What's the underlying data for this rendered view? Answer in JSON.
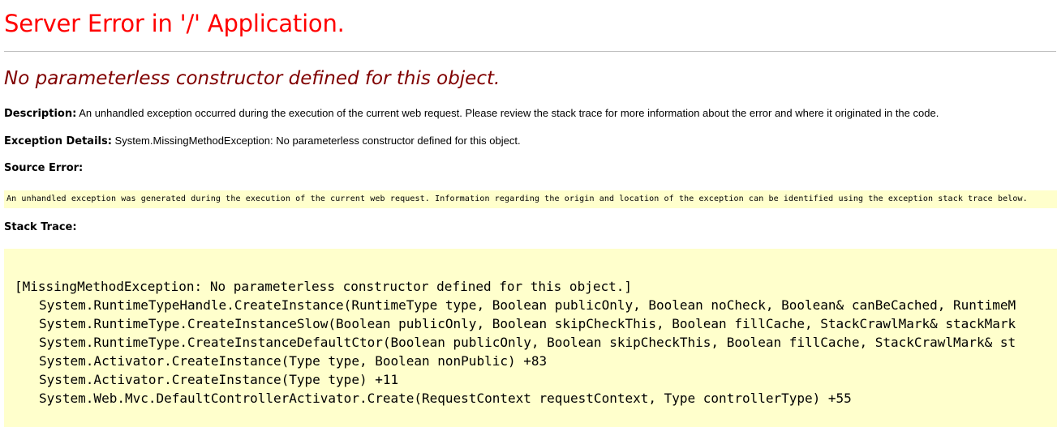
{
  "page": {
    "title": "Server Error in '/' Application.",
    "error_message": "No parameterless constructor defined for this object.",
    "description_label": "Description:",
    "description_text": "An unhandled exception occurred during the execution of the current web request. Please review the stack trace for more information about the error and where it originated in the code.",
    "exception_label": "Exception Details:",
    "exception_text": "System.MissingMethodException: No parameterless constructor defined for this object.",
    "source_error_heading": "Source Error:",
    "source_error_text": "An unhandled exception was generated during the execution of the current web request. Information regarding the origin and location of the exception can be identified using the exception stack trace below.",
    "stack_trace_heading": "Stack Trace:",
    "stack_trace": [
      "[MissingMethodException: No parameterless constructor defined for this object.]",
      "System.RuntimeTypeHandle.CreateInstance(RuntimeType type, Boolean publicOnly, Boolean noCheck, Boolean& canBeCached, RuntimeM",
      "System.RuntimeType.CreateInstanceSlow(Boolean publicOnly, Boolean skipCheckThis, Boolean fillCache, StackCrawlMark& stackMark",
      "System.RuntimeType.CreateInstanceDefaultCtor(Boolean publicOnly, Boolean skipCheckThis, Boolean fillCache, StackCrawlMark& st",
      "System.Activator.CreateInstance(Type type, Boolean nonPublic) +83",
      "System.Activator.CreateInstance(Type type) +11",
      "System.Web.Mvc.DefaultControllerActivator.Create(RequestContext requestContext, Type controllerType) +55"
    ]
  },
  "colors": {
    "title": "#ff0000",
    "error_message": "#800000",
    "code_background": "#ffffcc",
    "rule": "#c0c0c0"
  }
}
